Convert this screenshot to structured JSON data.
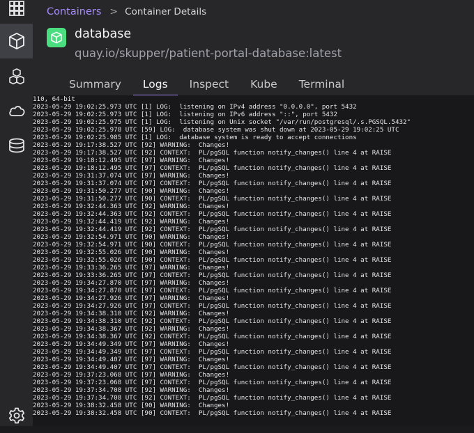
{
  "header": {
    "breadcrumb": {
      "link": "Containers",
      "separator": ">",
      "current": "Container Details"
    },
    "title": "database",
    "image": "quay.io/skupper/patient-portal-database:latest"
  },
  "tabs": [
    {
      "label": "Summary"
    },
    {
      "label": "Logs"
    },
    {
      "label": "Inspect"
    },
    {
      "label": "Kube"
    },
    {
      "label": "Terminal"
    }
  ],
  "sidebar": {
    "items": [
      {
        "icon": "dashboard-icon"
      },
      {
        "icon": "container-cube-icon"
      },
      {
        "icon": "images-cubes-icon"
      },
      {
        "icon": "cloud-icon"
      },
      {
        "icon": "database-icon"
      },
      {
        "icon": "gear-icon"
      }
    ]
  },
  "colors": {
    "accent": "#a78bfa",
    "sidebar_bg": "#27272a",
    "active_bg": "#3f3f46",
    "icon_green": "#4ade80"
  },
  "logs": [
    "110, 64-bit",
    "2023-05-29 19:02:25.973 UTC [1] LOG:  listening on IPv4 address \"0.0.0.0\", port 5432",
    "2023-05-29 19:02:25.973 UTC [1] LOG:  listening on IPv6 address \"::\", port 5432",
    "2023-05-29 19:02:25.975 UTC [1] LOG:  listening on Unix socket \"/var/run/postgresql/.s.PGSQL.5432\"",
    "2023-05-29 19:02:25.978 UTC [59] LOG:  database system was shut down at 2023-05-29 19:02:25 UTC",
    "2023-05-29 19:02:25.985 UTC [1] LOG:  database system is ready to accept connections",
    "2023-05-29 19:17:38.527 UTC [92] WARNING:  Changes!",
    "2023-05-29 19:17:38.527 UTC [92] CONTEXT:  PL/pgSQL function notify_changes() line 4 at RAISE",
    "2023-05-29 19:18:12.495 UTC [97] WARNING:  Changes!",
    "2023-05-29 19:18:12.495 UTC [97] CONTEXT:  PL/pgSQL function notify_changes() line 4 at RAISE",
    "2023-05-29 19:31:37.074 UTC [97] WARNING:  Changes!",
    "2023-05-29 19:31:37.074 UTC [97] CONTEXT:  PL/pgSQL function notify_changes() line 4 at RAISE",
    "2023-05-29 19:31:50.277 UTC [90] WARNING:  Changes!",
    "2023-05-29 19:31:50.277 UTC [90] CONTEXT:  PL/pgSQL function notify_changes() line 4 at RAISE",
    "2023-05-29 19:32:44.363 UTC [92] WARNING:  Changes!",
    "2023-05-29 19:32:44.363 UTC [92] CONTEXT:  PL/pgSQL function notify_changes() line 4 at RAISE",
    "2023-05-29 19:32:44.419 UTC [92] WARNING:  Changes!",
    "2023-05-29 19:32:44.419 UTC [92] CONTEXT:  PL/pgSQL function notify_changes() line 4 at RAISE",
    "2023-05-29 19:32:54.971 UTC [90] WARNING:  Changes!",
    "2023-05-29 19:32:54.971 UTC [90] CONTEXT:  PL/pgSQL function notify_changes() line 4 at RAISE",
    "2023-05-29 19:32:55.026 UTC [90] WARNING:  Changes!",
    "2023-05-29 19:32:55.026 UTC [90] CONTEXT:  PL/pgSQL function notify_changes() line 4 at RAISE",
    "2023-05-29 19:33:36.265 UTC [97] WARNING:  Changes!",
    "2023-05-29 19:33:36.265 UTC [97] CONTEXT:  PL/pgSQL function notify_changes() line 4 at RAISE",
    "2023-05-29 19:34:27.870 UTC [97] WARNING:  Changes!",
    "2023-05-29 19:34:27.870 UTC [97] CONTEXT:  PL/pgSQL function notify_changes() line 4 at RAISE",
    "2023-05-29 19:34:27.926 UTC [97] WARNING:  Changes!",
    "2023-05-29 19:34:27.926 UTC [97] CONTEXT:  PL/pgSQL function notify_changes() line 4 at RAISE",
    "2023-05-29 19:34:38.310 UTC [92] WARNING:  Changes!",
    "2023-05-29 19:34:38.310 UTC [92] CONTEXT:  PL/pgSQL function notify_changes() line 4 at RAISE",
    "2023-05-29 19:34:38.367 UTC [92] WARNING:  Changes!",
    "2023-05-29 19:34:38.367 UTC [92] CONTEXT:  PL/pgSQL function notify_changes() line 4 at RAISE",
    "2023-05-29 19:34:49.349 UTC [97] WARNING:  Changes!",
    "2023-05-29 19:34:49.349 UTC [97] CONTEXT:  PL/pgSQL function notify_changes() line 4 at RAISE",
    "2023-05-29 19:34:49.407 UTC [97] WARNING:  Changes!",
    "2023-05-29 19:34:49.407 UTC [97] CONTEXT:  PL/pgSQL function notify_changes() line 4 at RAISE",
    "2023-05-29 19:37:23.068 UTC [97] WARNING:  Changes!",
    "2023-05-29 19:37:23.068 UTC [97] CONTEXT:  PL/pgSQL function notify_changes() line 4 at RAISE",
    "2023-05-29 19:37:34.708 UTC [92] WARNING:  Changes!",
    "2023-05-29 19:37:34.708 UTC [92] CONTEXT:  PL/pgSQL function notify_changes() line 4 at RAISE",
    "2023-05-29 19:38:32.458 UTC [90] WARNING:  Changes!",
    "2023-05-29 19:38:32.458 UTC [90] CONTEXT:  PL/pgSQL function notify_changes() line 4 at RAISE"
  ]
}
